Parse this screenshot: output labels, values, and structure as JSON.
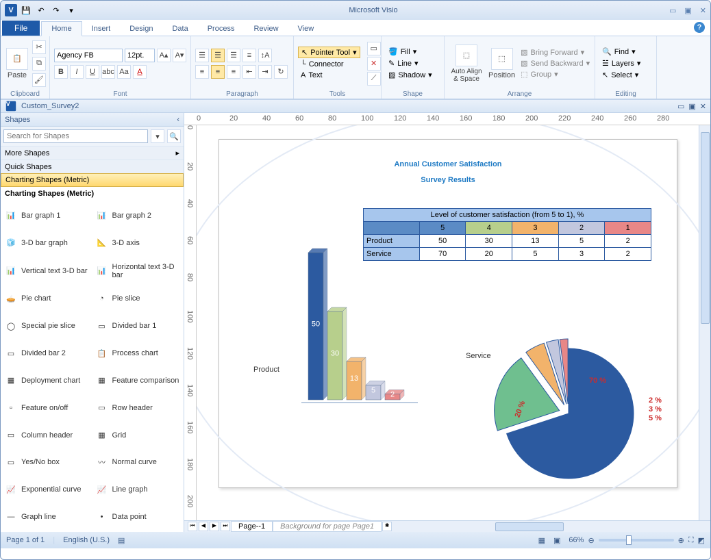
{
  "app_title": "Microsoft Visio",
  "doc_name": "Custom_Survey2",
  "file_tab": "File",
  "ribbon_tabs": [
    "Home",
    "Insert",
    "Design",
    "Data",
    "Process",
    "Review",
    "View"
  ],
  "active_tab": "Home",
  "ribbon": {
    "clipboard": {
      "label": "Clipboard",
      "paste": "Paste"
    },
    "font": {
      "label": "Font",
      "family": "Agency FB",
      "size": "12pt."
    },
    "paragraph": {
      "label": "Paragraph"
    },
    "tools": {
      "label": "Tools",
      "pointer": "Pointer Tool",
      "connector": "Connector",
      "text": "Text"
    },
    "shape": {
      "label": "Shape",
      "fill": "Fill",
      "line": "Line",
      "shadow": "Shadow"
    },
    "arrange": {
      "label": "Arrange",
      "autoalign": "Auto Align & Space",
      "position": "Position",
      "bringforward": "Bring Forward",
      "sendbackward": "Send Backward",
      "group": "Group"
    },
    "editing": {
      "label": "Editing",
      "find": "Find",
      "layers": "Layers",
      "select": "Select"
    }
  },
  "shapes_panel": {
    "title": "Shapes",
    "search_placeholder": "Search for Shapes",
    "more": "More Shapes",
    "quick": "Quick Shapes",
    "category_sel": "Charting Shapes (Metric)",
    "category_title": "Charting Shapes (Metric)",
    "items": [
      "Bar graph    1",
      "Bar graph    2",
      "3-D bar graph",
      "3-D axis",
      "Vertical text 3-D bar",
      "Horizontal text 3-D bar",
      "Pie chart",
      "Pie slice",
      "Special pie slice",
      "Divided bar 1",
      "Divided bar 2",
      "Process chart",
      "Deployment chart",
      "Feature comparison",
      "Feature on/off",
      "Row header",
      "Column header",
      "Grid",
      "Yes/No box",
      "Normal curve",
      "Exponential curve",
      "Line graph",
      "Graph line",
      "Data point"
    ]
  },
  "page": {
    "title_line1": "Annual Customer Satisfaction",
    "title_line2": "Survey Results",
    "table_header": "Level of customer satisfaction (from 5 to 1), %",
    "levels": [
      "5",
      "4",
      "3",
      "2",
      "1"
    ],
    "row1_label": "Product",
    "row2_label": "Service",
    "product": [
      50,
      30,
      13,
      5,
      2
    ],
    "service": [
      70,
      20,
      5,
      3,
      2
    ],
    "product_label": "Product",
    "service_label": "Service"
  },
  "chart_data": [
    {
      "type": "bar",
      "title": "Product",
      "categories": [
        "5",
        "4",
        "3",
        "2",
        "1"
      ],
      "values": [
        50,
        30,
        13,
        5,
        2
      ],
      "ylabel": "%",
      "ylim": [
        0,
        70
      ]
    },
    {
      "type": "pie",
      "title": "Service",
      "series": [
        {
          "name": "5",
          "value": 70
        },
        {
          "name": "4",
          "value": 20
        },
        {
          "name": "3",
          "value": 5
        },
        {
          "name": "2",
          "value": 3
        },
        {
          "name": "1",
          "value": 2
        }
      ]
    }
  ],
  "colors": {
    "bar": [
      "#2c5aa0",
      "#b7cf8c",
      "#f2b36b",
      "#c2c7de",
      "#e88787"
    ],
    "tablehead": [
      "#5b8bc5",
      "#b7cf8c",
      "#f2b36b",
      "#c2c7de",
      "#e88787"
    ],
    "pie": [
      "#2c5aa0",
      "#6fbf8f",
      "#f2b36b",
      "#c2c7de",
      "#e88787"
    ]
  },
  "page_nav": {
    "tab1": "Page--1",
    "tab2": "Background for page Page1"
  },
  "status": {
    "page": "Page 1 of 1",
    "lang": "English (U.S.)",
    "zoom": "66%"
  },
  "ruler_h": [
    0,
    20,
    40,
    60,
    80,
    100,
    120,
    140,
    160,
    180,
    200,
    220,
    240,
    260,
    280
  ],
  "ruler_v": [
    0,
    20,
    40,
    60,
    80,
    100,
    120,
    140,
    160,
    180,
    200
  ]
}
